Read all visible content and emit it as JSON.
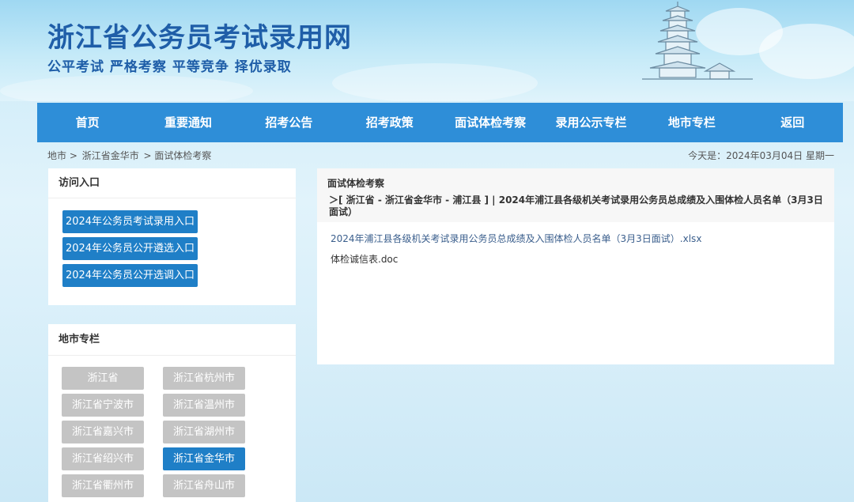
{
  "header": {
    "title": "浙江省公务员考试录用网",
    "slogan": "公平考试 严格考察 平等竞争 择优录取"
  },
  "nav": [
    "首页",
    "重要通知",
    "招考公告",
    "招考政策",
    "面试体检考察",
    "录用公示专栏",
    "地市专栏",
    "返回"
  ],
  "breadcrumb": [
    "地市 >",
    "浙江省金华市",
    "> 面试体检考察"
  ],
  "date_text": "今天是：2024年03月04日 星期一",
  "access": {
    "title": "访问入口",
    "buttons": [
      "2024年公务员考试录用入口",
      "2024年公务员公开遴选入口",
      "2024年公务员公开选调入口"
    ]
  },
  "cities": {
    "title": "地市专栏",
    "items": [
      "浙江省",
      "浙江省杭州市",
      "浙江省宁波市",
      "浙江省温州市",
      "浙江省嘉兴市",
      "浙江省湖州市",
      "浙江省绍兴市",
      "浙江省金华市",
      "浙江省衢州市",
      "浙江省舟山市"
    ],
    "active": "浙江省金华市"
  },
  "content": {
    "section_title": "面试体检考察",
    "path": "＞[ 浙江省 - 浙江省金华市 - 浦江县 ] | 2024年浦江县各级机关考试录用公务员总成绩及入围体检人员名单（3月3日面试）",
    "files": [
      "2024年浦江县各级机关考试录用公务员总成绩及入围体检人员名单（3月3日面试）.xlsx",
      "体检诚信表.doc"
    ]
  },
  "colors": {
    "nav": "#2e8ed8",
    "title": "#1f5ea8",
    "button": "#1f7fc7",
    "city_inactive": "#c4c4c4"
  }
}
